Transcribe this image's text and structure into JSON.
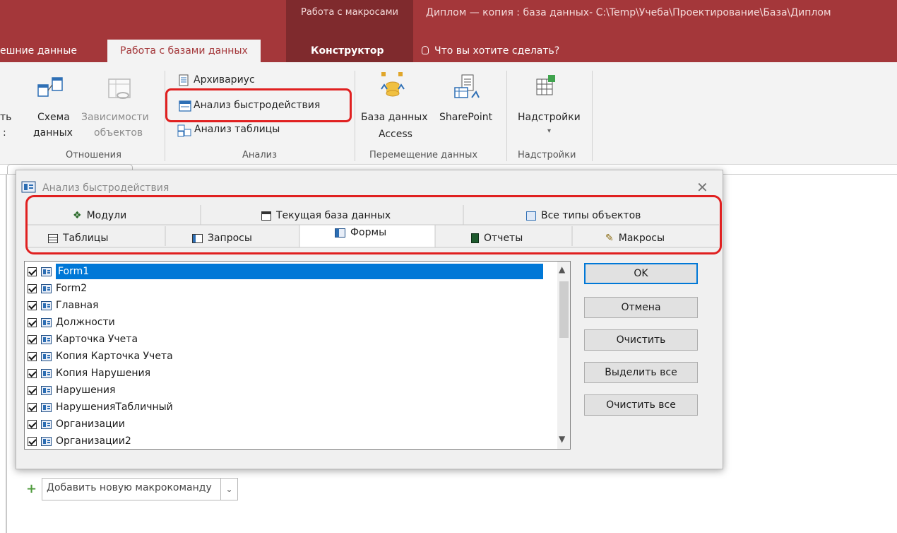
{
  "titlebar": {
    "context_group": "Работа с макросами",
    "window_title": "Диплом — копия : база данных- C:\\Temp\\Учеба\\Проектирование\\База\\Диплом"
  },
  "ribbon_tabs": {
    "external_data": "ешние данные",
    "database_tools": "Работа с базами данных",
    "designer": "Конструктор",
    "tell_me": "Что вы хотите сделать?"
  },
  "ribbon": {
    "partial_left_1": "ть",
    "partial_left_2": ":",
    "schema_line1": "Схема",
    "schema_line2": "данных",
    "deps_line1": "Зависимости",
    "deps_line2": "объектов",
    "group_relations": "Отношения",
    "documenter": "Архивариус",
    "performance": "Анализ быстродействия",
    "table_analyze": "Анализ таблицы",
    "group_analyze": "Анализ",
    "access_db_line1": "База данных",
    "access_db_line2": "Access",
    "sharepoint": "SharePoint",
    "group_move": "Перемещение данных",
    "addins": "Надстройки",
    "group_addins": "Надстройки"
  },
  "dialog": {
    "title": "Анализ быстродействия",
    "tabs_row1": [
      "Модули",
      "Текущая база данных",
      "Все типы объектов"
    ],
    "tabs_row2": [
      "Таблицы",
      "Запросы",
      "Формы",
      "Отчеты",
      "Макросы"
    ],
    "items": [
      "Form1",
      "Form2",
      "Главная",
      "Должности",
      "Карточка Учета",
      "Копия Карточка Учета",
      "Копия Нарушения",
      "Нарушения",
      "НарушенияТабличный",
      "Организации",
      "Организации2"
    ],
    "buttons": {
      "ok": "OK",
      "cancel": "Отмена",
      "clear": "Очистить",
      "select_all": "Выделить все",
      "clear_all": "Очистить все"
    }
  },
  "macro": {
    "add_new": "Добавить новую макрокоманду"
  },
  "colors": {
    "accent": "#a4373a",
    "highlight": "#e02020",
    "selection": "#0078d7"
  }
}
